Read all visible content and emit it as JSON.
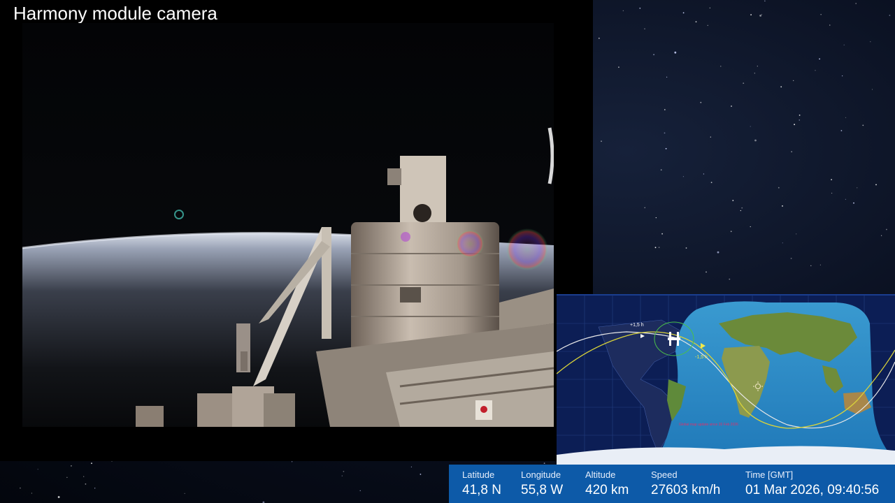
{
  "camera": {
    "title": "Harmony module camera"
  },
  "map": {
    "orbit_marks": {
      "ahead": "+1,5 h",
      "behind": "-1,5 h"
    },
    "footer_note": "Global map update since 20 Feb 2026"
  },
  "telemetry": {
    "latitude": {
      "label": "Latitude",
      "value": "41,8 N"
    },
    "longitude": {
      "label": "Longitude",
      "value": "55,8 W"
    },
    "altitude": {
      "label": "Altitude",
      "value": "420 km"
    },
    "speed": {
      "label": "Speed",
      "value": "27603 km/h"
    },
    "time": {
      "label": "Time [GMT]",
      "value": "01 Mar 2026, 09:40:56"
    }
  },
  "colors": {
    "telemetry_bar": "#0d5aa8",
    "map_ocean": "#0c1e55",
    "daylight_ocean": "#2b86c2",
    "orbit_future": "#d8d23a",
    "orbit_past": "#e8e8e8"
  },
  "icons": {
    "iss": "iss-icon",
    "sun": "sun-icon"
  }
}
